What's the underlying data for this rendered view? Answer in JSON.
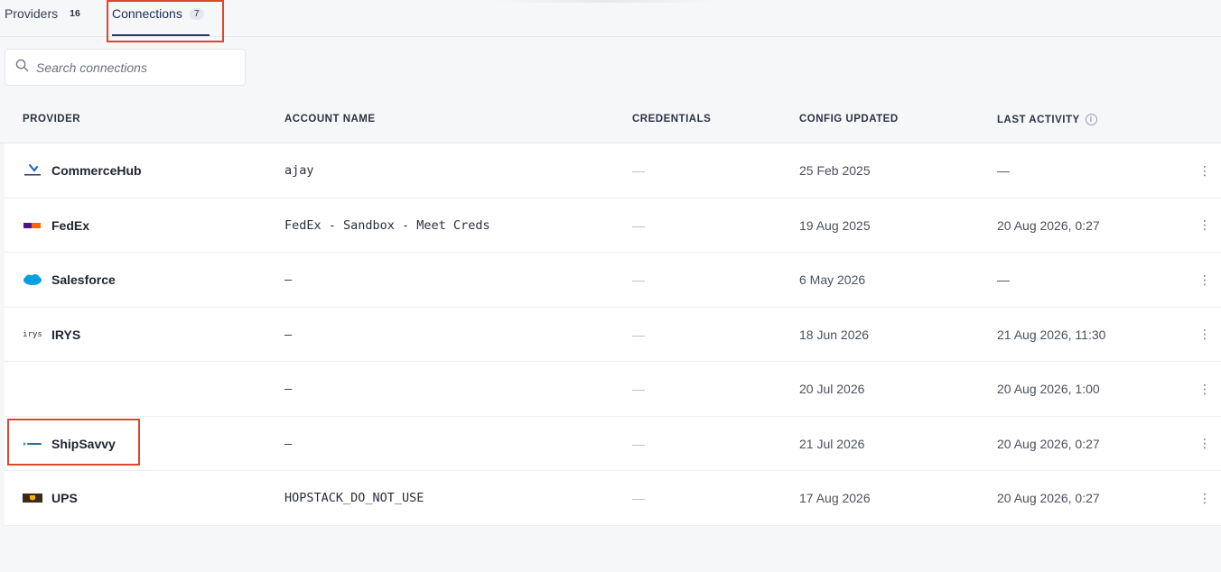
{
  "tabs": [
    {
      "label": "Providers",
      "count": "16"
    },
    {
      "label": "Connections",
      "count": "7"
    }
  ],
  "search": {
    "placeholder": "Search connections"
  },
  "columns": {
    "provider": "PROVIDER",
    "account": "ACCOUNT NAME",
    "credentials": "CREDENTIALS",
    "config": "CONFIG UPDATED",
    "activity": "LAST ACTIVITY",
    "info_glyph": "i"
  },
  "rows": [
    {
      "provider": "CommerceHub",
      "logo": "commercehub-logo",
      "account": "ajay",
      "credentials": "—",
      "config": "25 Feb 2025",
      "activity": "—",
      "menu": "⋮"
    },
    {
      "provider": "FedEx",
      "logo": "fedex-logo",
      "account": "FedEx - Sandbox - Meet Creds",
      "credentials": "—",
      "config": "19 Aug 2025",
      "activity": "20 Aug 2026, 0:27",
      "menu": "⋮"
    },
    {
      "provider": "Salesforce",
      "logo": "salesforce-logo",
      "account": "–",
      "credentials": "—",
      "config": "6 May 2026",
      "activity": "—",
      "menu": "⋮"
    },
    {
      "provider": "IRYS",
      "logo": "irys-logo",
      "logo_text": "irys",
      "account": "–",
      "credentials": "—",
      "config": "18 Jun 2026",
      "activity": "21 Aug 2026, 11:30",
      "menu": "⋮"
    },
    {
      "provider": "",
      "logo": "",
      "account": "–",
      "credentials": "—",
      "config": "20 Jul 2026",
      "activity": "20 Aug 2026, 1:00",
      "menu": "⋮"
    },
    {
      "provider": "ShipSavvy",
      "logo": "shipsavvy-logo",
      "account": "–",
      "credentials": "—",
      "config": "21 Jul 2026",
      "activity": "20 Aug 2026, 0:27",
      "menu": "⋮"
    },
    {
      "provider": "UPS",
      "logo": "ups-logo",
      "account": "HOPSTACK_DO_NOT_USE",
      "credentials": "—",
      "config": "17 Aug 2026",
      "activity": "20 Aug 2026, 0:27",
      "menu": "⋮"
    }
  ],
  "colors": {
    "highlight": "#e0452e",
    "tab_active": "#2d3a66"
  }
}
